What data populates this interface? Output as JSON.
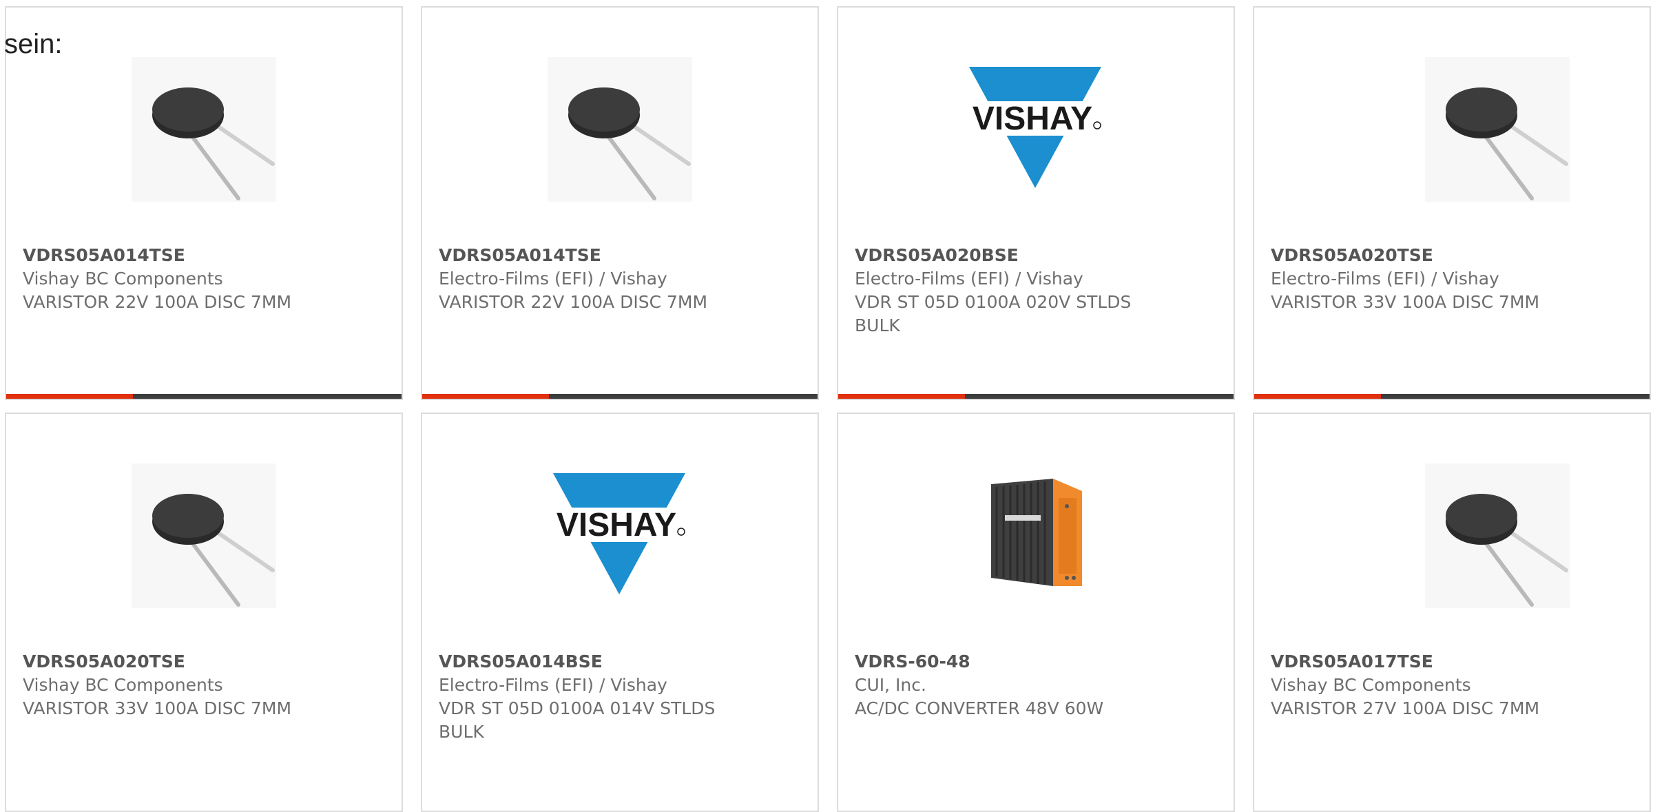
{
  "intro_text": "sein:",
  "colors": {
    "accent_bar": "#e0300e",
    "base_bar": "#3d3d3d",
    "vishay_blue": "#1b8fcf",
    "converter_orange": "#f08a2c"
  },
  "products": [
    {
      "part_number": "VDRS05A014TSE",
      "manufacturer": "Vishay BC Components",
      "description_line1": "VARISTOR 22V 100A DISC 7MM",
      "description_line2": "",
      "image": "disc-varistor-icon",
      "progress": 0.32
    },
    {
      "part_number": "VDRS05A014TSE",
      "manufacturer": "Electro-Films (EFI) / Vishay",
      "description_line1": "VARISTOR 22V 100A DISC 7MM",
      "description_line2": "",
      "image": "disc-varistor-icon",
      "progress": 0.32
    },
    {
      "part_number": "VDRS05A020BSE",
      "manufacturer": "Electro-Films (EFI) / Vishay",
      "description_line1": "VDR ST 05D 0100A 020V STLDS",
      "description_line2": "BULK",
      "image": "vishay-logo",
      "logo_text": "VISHAY",
      "progress": 0.32
    },
    {
      "part_number": "VDRS05A020TSE",
      "manufacturer": "Electro-Films (EFI) / Vishay",
      "description_line1": "VARISTOR 33V 100A DISC 7MM",
      "description_line2": "",
      "image": "disc-varistor-icon",
      "progress": 0.32
    },
    {
      "part_number": "VDRS05A020TSE",
      "manufacturer": "Vishay BC Components",
      "description_line1": "VARISTOR 33V 100A DISC 7MM",
      "description_line2": "",
      "image": "disc-varistor-icon"
    },
    {
      "part_number": "VDRS05A014BSE",
      "manufacturer": "Electro-Films (EFI) / Vishay",
      "description_line1": "VDR ST 05D 0100A 014V STLDS",
      "description_line2": "BULK",
      "image": "vishay-logo",
      "logo_text": "VISHAY"
    },
    {
      "part_number": "VDRS-60-48",
      "manufacturer": "CUI, Inc.",
      "description_line1": "AC/DC CONVERTER 48V 60W",
      "description_line2": "",
      "image": "din-rail-power-supply-icon"
    },
    {
      "part_number": "VDRS05A017TSE",
      "manufacturer": "Vishay BC Components",
      "description_line1": "VARISTOR 27V 100A DISC 7MM",
      "description_line2": "",
      "image": "disc-varistor-icon"
    }
  ]
}
